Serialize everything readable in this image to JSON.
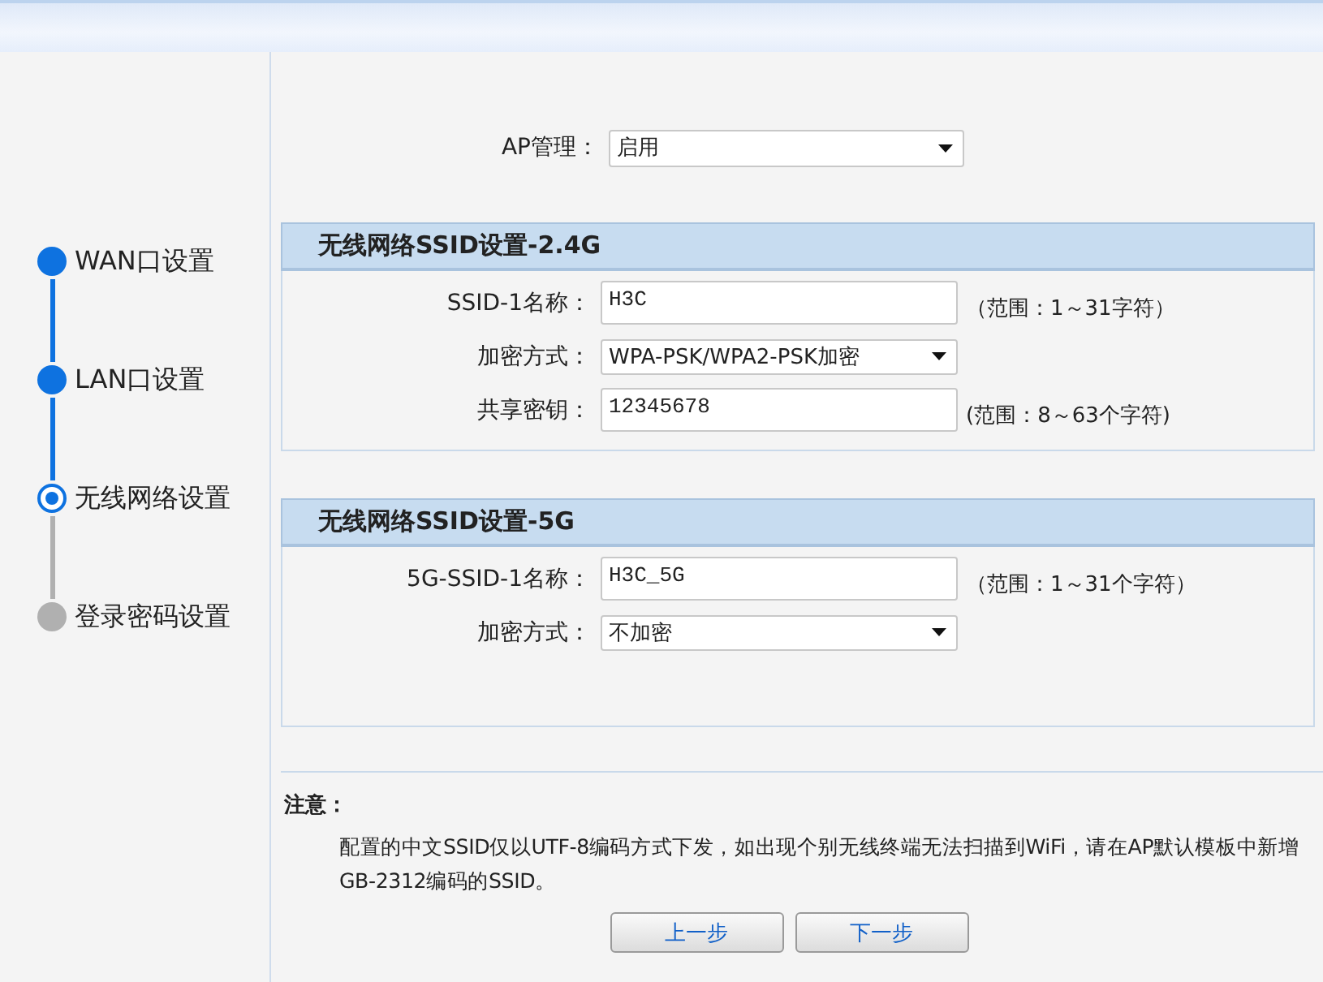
{
  "steps": [
    {
      "label": "WAN口设置",
      "completed": true,
      "selected": false
    },
    {
      "label": "LAN口设置",
      "completed": true,
      "selected": false
    },
    {
      "label": "无线网络设置",
      "completed": false,
      "selected": true
    },
    {
      "label": "登录密码设置",
      "completed": false,
      "selected": false
    }
  ],
  "ap_management": {
    "label": "AP管理：",
    "value": "启用"
  },
  "sections": [
    {
      "title": "无线网络SSID设置-2.4G",
      "fields": [
        {
          "kind": "text",
          "label": "SSID-1名称：",
          "value": "H3C",
          "hint": "（范围：1～31字符）"
        },
        {
          "kind": "select",
          "label": "加密方式：",
          "value": "WPA-PSK/WPA2-PSK加密"
        },
        {
          "kind": "text",
          "label": "共享密钥：",
          "value": "12345678",
          "hint": "(范围：8～63个字符)"
        }
      ]
    },
    {
      "title": "无线网络SSID设置-5G",
      "fields": [
        {
          "kind": "text",
          "label": "5G-SSID-1名称：",
          "value": "H3C_5G",
          "hint": "（范围：1～31个字符）"
        },
        {
          "kind": "select",
          "label": "加密方式：",
          "value": "不加密"
        }
      ]
    }
  ],
  "note": {
    "title": "注意：",
    "text": "配置的中文SSID仅以UTF-8编码方式下发，如出现个别无线终端无法扫描到WiFi，请在AP默认模板中新增GB-2312编码的SSID。"
  },
  "buttons": [
    "上一步",
    "下一步"
  ]
}
